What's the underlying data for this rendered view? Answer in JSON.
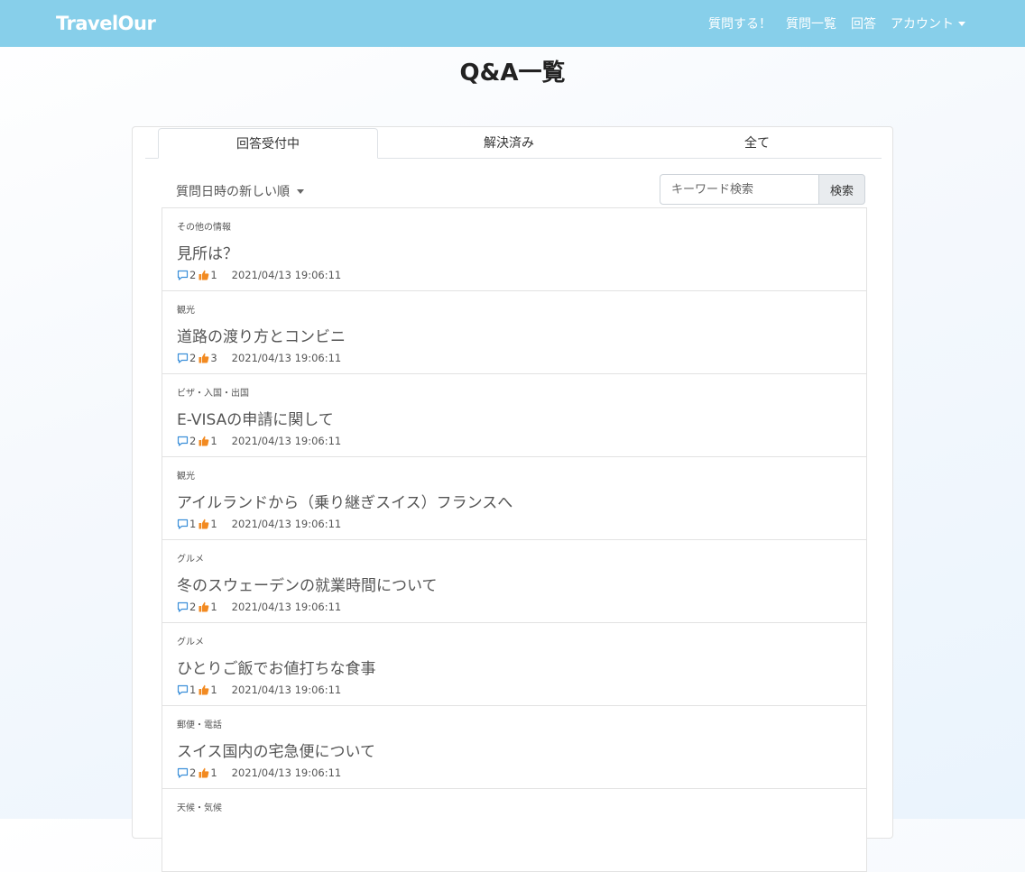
{
  "navbar": {
    "brand": "TravelOur",
    "links": [
      "質問する！",
      "質問一覧",
      "回答",
      "アカウント"
    ]
  },
  "page": {
    "title": "Q&A一覧"
  },
  "tabs": [
    "回答受付中",
    "解決済み",
    "全て"
  ],
  "toolbar": {
    "sort_label": "質問日時の新しい順",
    "search_placeholder": "キーワード検索",
    "search_button": "検索"
  },
  "colors": {
    "navbar": "#87cfea",
    "comment_icon": "#3b8fd9",
    "like_icon": "#f28a21"
  },
  "questions": [
    {
      "category": "その他の情報",
      "title": "見所は？",
      "comments": "2",
      "likes": "1",
      "date": "2021/04/13 19:06:11"
    },
    {
      "category": "観光",
      "title": "道路の渡り方とコンビニ",
      "comments": "2",
      "likes": "3",
      "date": "2021/04/13 19:06:11"
    },
    {
      "category": "ビザ・入国・出国",
      "title": "E-VISAの申請に関して",
      "comments": "2",
      "likes": "1",
      "date": "2021/04/13 19:06:11"
    },
    {
      "category": "観光",
      "title": "アイルランドから（乗り継ぎスイス）フランスへ",
      "comments": "1",
      "likes": "1",
      "date": "2021/04/13 19:06:11"
    },
    {
      "category": "グルメ",
      "title": "冬のスウェーデンの就業時間について",
      "comments": "2",
      "likes": "1",
      "date": "2021/04/13 19:06:11"
    },
    {
      "category": "グルメ",
      "title": "ひとりご飯でお値打ちな食事",
      "comments": "1",
      "likes": "1",
      "date": "2021/04/13 19:06:11"
    },
    {
      "category": "郵便・電話",
      "title": "スイス国内の宅急便について",
      "comments": "2",
      "likes": "1",
      "date": "2021/04/13 19:06:11"
    },
    {
      "category": "天候・気候"
    }
  ]
}
